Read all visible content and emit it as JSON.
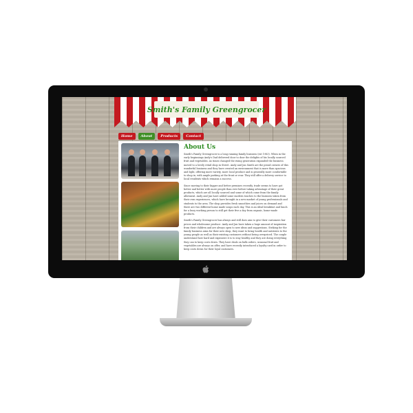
{
  "site": {
    "logo": "Smith's Family Greengrocer",
    "nav": [
      "Home",
      "About",
      "Products",
      "Contact"
    ],
    "heading": "About Us",
    "paragraphs": [
      "Smith's Family Greengrocer is a long running family business (est 1983). When in the early beginnings Andy's Dad delivered door to door the delights of his locally sourced fruit and vegetables. As times changed the rising generation expanded the business moved to a lovely retail shop in Street. Andy and Jan Smith are the proud owners of this wonderful business and they have created an environment that is more than spacious and light, offering more variety, more local produce and is generally more comfortable to shop in, with ample parking at the front or rear. They still offer a delivery service to local residents which remains a success.",
      "Since moving to their bigger and better premises recently, trade seems to have got better and better with more people than ever before taking advantage of their great products, which are all locally sourced and some of which come from the family allotment. Andy and Jan have added some modern touches to the business taken from their own experiences, which have brought in a new market of young professionals and students to the area. The shop provides fresh smoothies and juices on demand and there are two different home made soups each day. This is an ideal breakfast and lunch for a busy working person to still get their five a day from organic, home-made products.",
      "Smith's Family Greengrocer has always and still does aim to give their customers fair prices and wholesome produce. Andy and Jan have taken a huge amount of inspiration from their children and are always open to new ideas and suggestions. Striking for the family business aims for their new shop, they want to bring health and nutrients to the young people as well as their existing customers without being overpriced. The couple understand how hard and expensive it is to stay healthy and they are doing everything they can to keep costs down. They have deals on bulk orders, seasonal fruit and vegetables are always on offer, and have recently introduced a loyalty card in order to keep costs down for their loyal customers."
    ]
  },
  "colors": {
    "awning_red": "#c41920",
    "brand_green": "#2a8a1e",
    "wood": "#bcb4a6"
  },
  "icons": {
    "apple": "apple-logo-icon"
  }
}
